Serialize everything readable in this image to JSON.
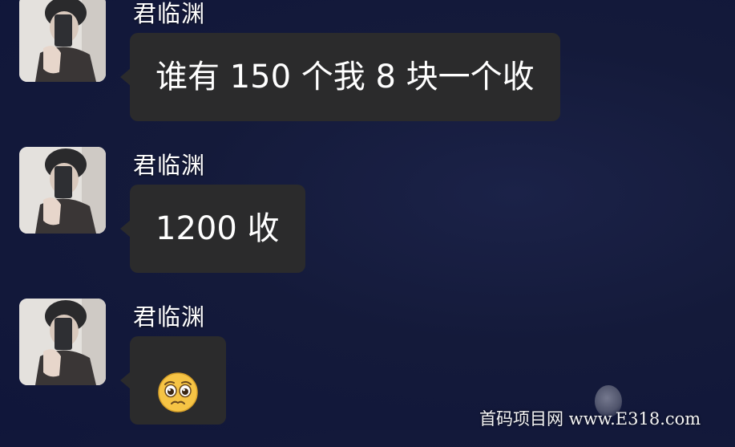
{
  "messages": [
    {
      "sender": "君临渊",
      "text": "谁有 150 个我 8 块一个收",
      "type": "text"
    },
    {
      "sender": "君临渊",
      "text": "1200 收",
      "type": "text"
    },
    {
      "sender": "君临渊",
      "text": "",
      "type": "emoji",
      "emoji": "pleading-face-emoji"
    }
  ],
  "watermark": "首码项目网 www.E318.com",
  "colors": {
    "background": "#141a3a",
    "bubble": "#2b2b2c",
    "text": "#ffffff",
    "emoji_face": "#f6c445"
  }
}
